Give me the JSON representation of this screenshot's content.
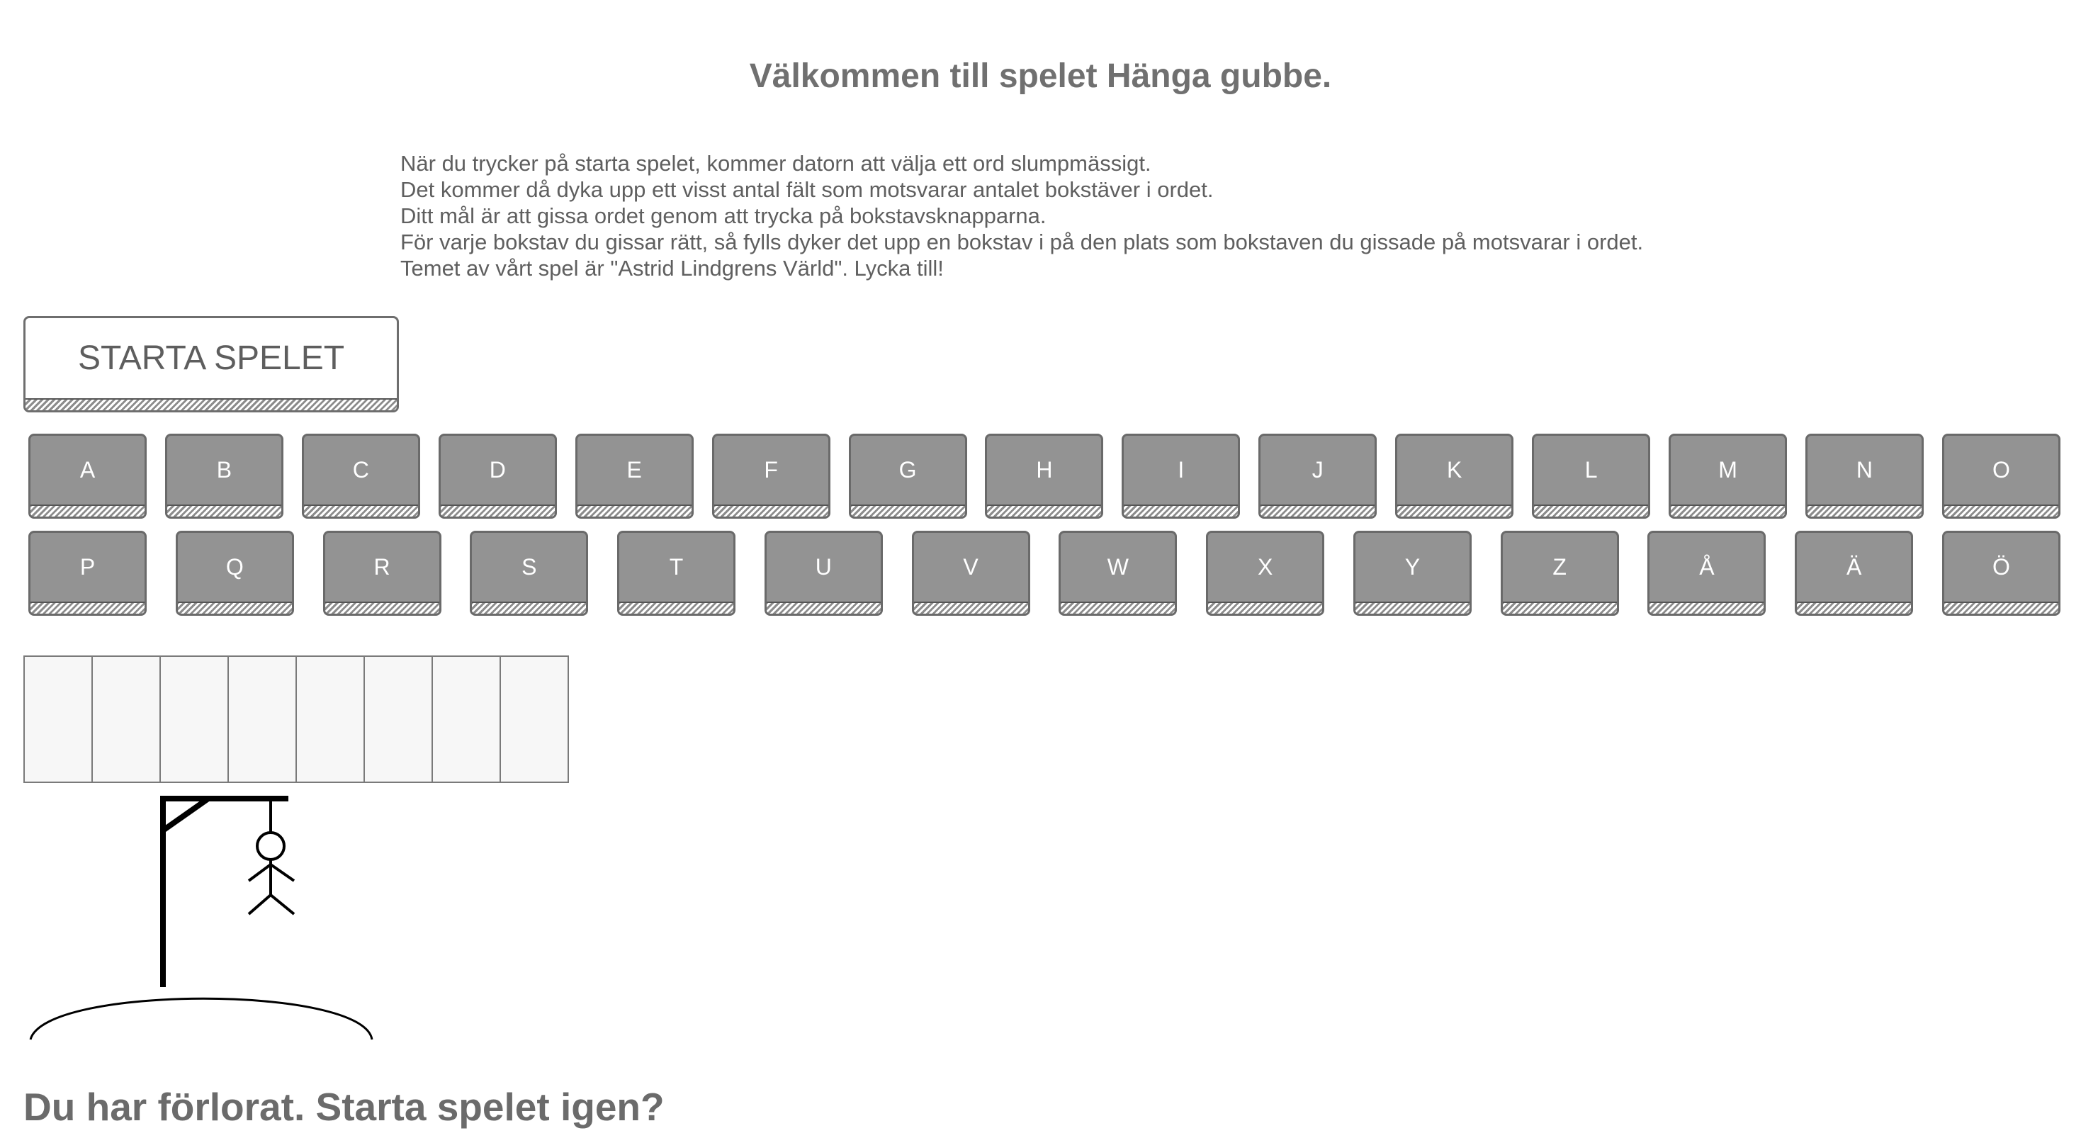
{
  "title": "Välkommen till spelet Hänga gubbe.",
  "instructions": [
    "När du trycker på starta spelet, kommer datorn att välja ett ord slumpmässigt.",
    "Det kommer då dyka upp ett visst antal fält som motsvarar antalet bokstäver i ordet.",
    "Ditt mål är att gissa ordet genom att trycka på bokstavsknapparna.",
    "För varje bokstav du gissar rätt, så fylls dyker det upp en bokstav i på den plats som bokstaven du gissade på motsvarar i ordet.",
    "Temet av vårt spel är \"Astrid Lindgrens Värld\". Lycka till!"
  ],
  "start_button": "STARTA SPELET",
  "keyboard": {
    "row1": [
      "A",
      "B",
      "C",
      "D",
      "E",
      "F",
      "G",
      "H",
      "I",
      "J",
      "K",
      "L",
      "M",
      "N",
      "O"
    ],
    "row2": [
      "P",
      "Q",
      "R",
      "S",
      "T",
      "U",
      "V",
      "W",
      "X",
      "Y",
      "Z",
      "Å",
      "Ä",
      "Ö"
    ]
  },
  "word_slots": [
    "",
    "",
    "",
    "",
    "",
    "",
    "",
    ""
  ],
  "result_message": "Du har förlorat. Starta spelet igen?",
  "colors": {
    "key_background": "#939393",
    "text": "#6b6b6b",
    "slot_background": "#f7f7f7"
  }
}
